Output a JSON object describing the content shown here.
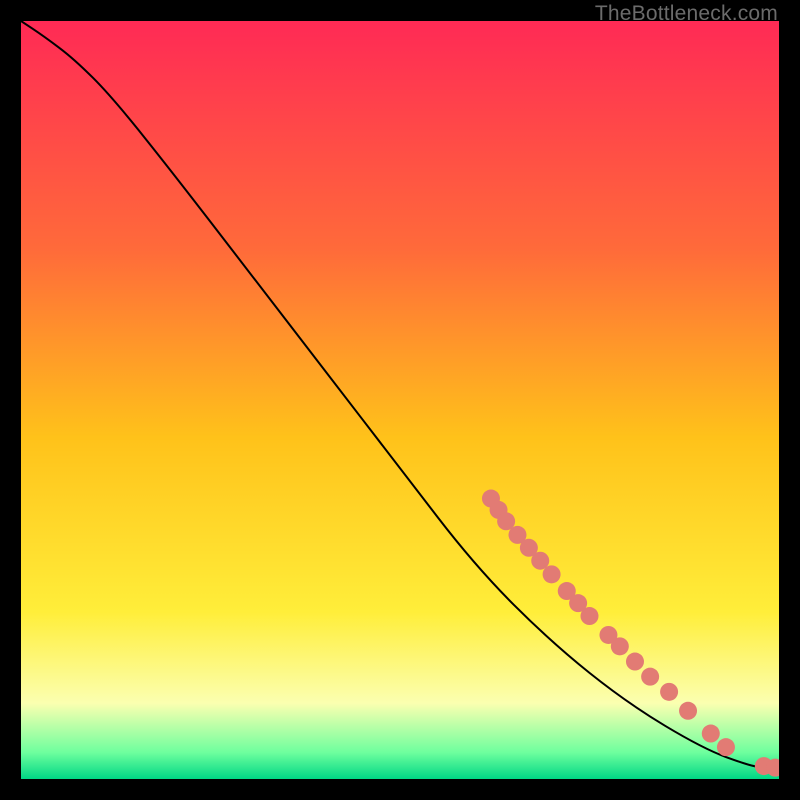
{
  "watermark": "TheBottleneck.com",
  "chart_data": {
    "type": "line",
    "title": "",
    "xlabel": "",
    "ylabel": "",
    "xlim": [
      0,
      100
    ],
    "ylim": [
      0,
      100
    ],
    "grid": false,
    "legend": false,
    "background_gradient": [
      {
        "stop": 0.0,
        "color": "#ff2a55"
      },
      {
        "stop": 0.3,
        "color": "#ff6a3a"
      },
      {
        "stop": 0.55,
        "color": "#ffc21a"
      },
      {
        "stop": 0.78,
        "color": "#ffee3a"
      },
      {
        "stop": 0.9,
        "color": "#fbffb0"
      },
      {
        "stop": 0.965,
        "color": "#6eff9e"
      },
      {
        "stop": 1.0,
        "color": "#00d785"
      }
    ],
    "curve": {
      "x": [
        0,
        3,
        7,
        12,
        20,
        30,
        40,
        50,
        60,
        70,
        80,
        90,
        96,
        98,
        100
      ],
      "y": [
        100,
        98,
        95,
        90,
        80,
        67,
        54,
        41,
        28,
        18,
        10,
        4,
        1.8,
        1.5,
        1.5
      ]
    },
    "markers": {
      "size": 9,
      "color": "#e27b74",
      "points": [
        {
          "x": 62,
          "y": 37
        },
        {
          "x": 63,
          "y": 35.5
        },
        {
          "x": 64,
          "y": 34
        },
        {
          "x": 65.5,
          "y": 32.2
        },
        {
          "x": 67,
          "y": 30.5
        },
        {
          "x": 68.5,
          "y": 28.8
        },
        {
          "x": 70,
          "y": 27
        },
        {
          "x": 72,
          "y": 24.8
        },
        {
          "x": 73.5,
          "y": 23.2
        },
        {
          "x": 75,
          "y": 21.5
        },
        {
          "x": 77.5,
          "y": 19
        },
        {
          "x": 79,
          "y": 17.5
        },
        {
          "x": 81,
          "y": 15.5
        },
        {
          "x": 83,
          "y": 13.5
        },
        {
          "x": 85.5,
          "y": 11.5
        },
        {
          "x": 88,
          "y": 9
        },
        {
          "x": 91,
          "y": 6
        },
        {
          "x": 93,
          "y": 4.2
        },
        {
          "x": 98,
          "y": 1.7
        },
        {
          "x": 99.5,
          "y": 1.5
        }
      ]
    }
  }
}
